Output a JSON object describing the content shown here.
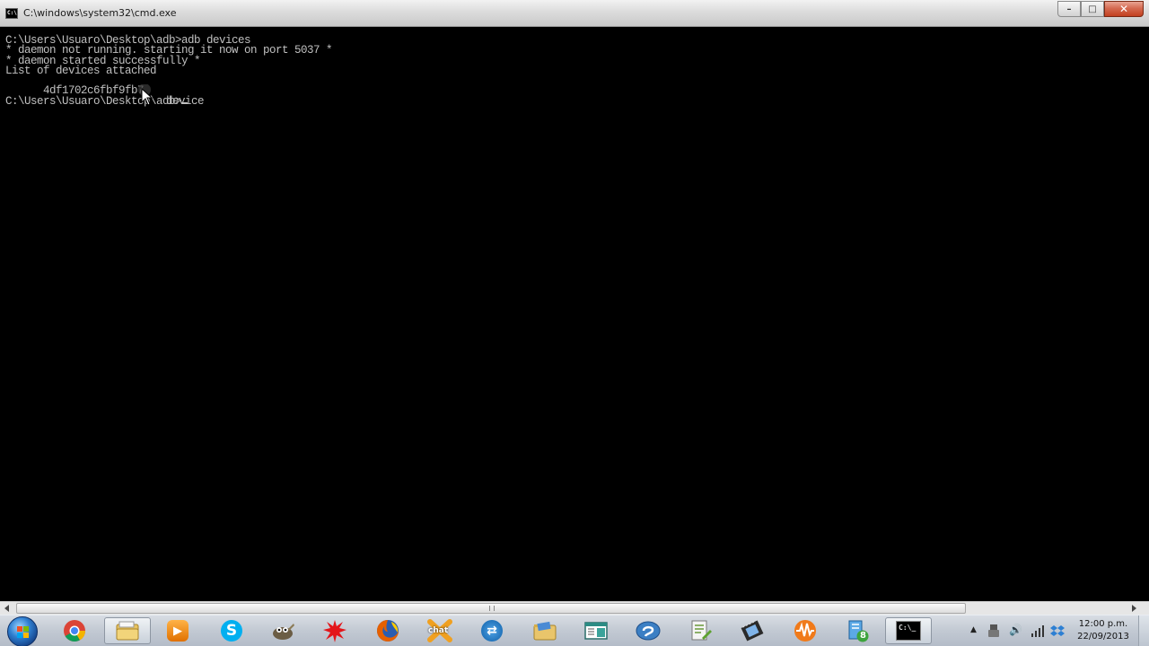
{
  "window": {
    "icon_label": "C:\\",
    "title": "C:\\windows\\system32\\cmd.exe",
    "buttons": {
      "minimize": "–",
      "maximize": "□",
      "close": "✕"
    }
  },
  "console": {
    "lines": [
      "C:\\Users\\Usuaro\\Desktop\\adb>adb devices",
      "* daemon not running. starting it now on port 5037 *",
      "* daemon started successfully *",
      "List of devices attached"
    ],
    "device_serial": "4df1702c6fbf9fb7",
    "device_state": "device",
    "prompt": "C:\\Users\\Usuaro\\Desktop\\adb>"
  },
  "scrollbar": {
    "grip": "⁞"
  },
  "taskbar": {
    "icons": [
      {
        "name": "chrome-icon",
        "glyph": ""
      },
      {
        "name": "file-explorer-icon",
        "glyph": ""
      },
      {
        "name": "media-player-icon",
        "glyph": "▶"
      },
      {
        "name": "skype-icon",
        "glyph": "S"
      },
      {
        "name": "gimp-icon",
        "glyph": ""
      },
      {
        "name": "splash-app-icon",
        "glyph": ""
      },
      {
        "name": "firefox-icon",
        "glyph": ""
      },
      {
        "name": "chat-app-icon",
        "glyph": "chat"
      },
      {
        "name": "teamviewer-icon",
        "glyph": "⇄"
      },
      {
        "name": "folder-icon",
        "glyph": ""
      },
      {
        "name": "window-app-icon",
        "glyph": ""
      },
      {
        "name": "messenger-icon",
        "glyph": ""
      },
      {
        "name": "notepad-icon",
        "glyph": ""
      },
      {
        "name": "video-editor-icon",
        "glyph": ""
      },
      {
        "name": "audio-app-icon",
        "glyph": ""
      },
      {
        "name": "installer-icon",
        "glyph": "8"
      },
      {
        "name": "cmd-taskbar-icon",
        "glyph": "C:\\_"
      }
    ],
    "tray": {
      "show_hidden": "▲",
      "volume": "🔊"
    },
    "clock": {
      "time": "12:00 p.m.",
      "date": "22/09/2013"
    }
  },
  "colors": {
    "console_bg": "#000000",
    "console_text": "#c0c0c0",
    "close_button": "#c2401f",
    "taskbar": "#c2c9d3"
  }
}
